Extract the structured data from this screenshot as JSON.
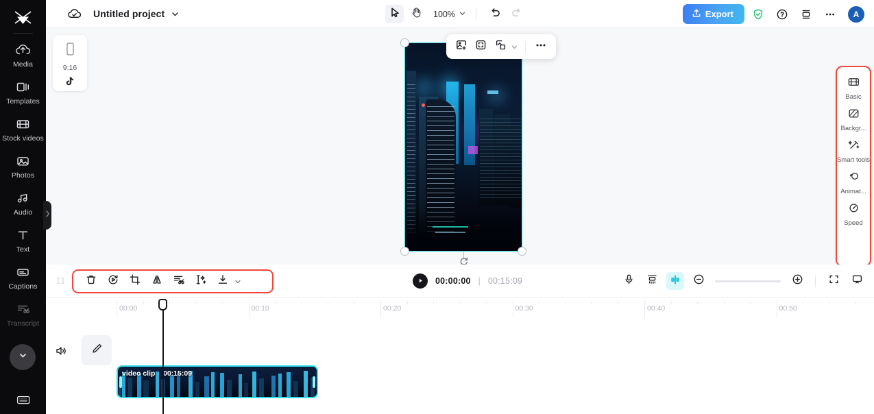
{
  "app": {
    "name": "CapCut Web Editor",
    "accent_blue": "#3a7df5",
    "accent_cyan": "#2ee0ea",
    "highlight_red": "#f2463a"
  },
  "sidebar": {
    "logo_icon": "capcut-logo-icon",
    "items": [
      {
        "label": "Media",
        "icon": "cloud-upload-icon"
      },
      {
        "label": "Templates",
        "icon": "templates-icon"
      },
      {
        "label": "Stock videos",
        "icon": "film-strip-icon"
      },
      {
        "label": "Photos",
        "icon": "photo-icon"
      },
      {
        "label": "Audio",
        "icon": "music-note-icon"
      },
      {
        "label": "Text",
        "icon": "text-t-icon"
      },
      {
        "label": "Captions",
        "icon": "captions-icon"
      },
      {
        "label": "Transcript",
        "icon": "transcript-scissors-icon"
      }
    ],
    "collapse_icon": "chevron-down-icon",
    "keyboard_icon": "keyboard-icon",
    "panel_handle_icon": "chevron-right-icon"
  },
  "topbar": {
    "cloud_icon": "cloud-saved-icon",
    "project_title": "Untitled project",
    "title_caret_icon": "chevron-down-icon",
    "tools": [
      {
        "name": "select-tool",
        "icon": "cursor-arrow-icon",
        "active": true
      },
      {
        "name": "hand-tool",
        "icon": "hand-icon",
        "active": false
      }
    ],
    "zoom_level": "100%",
    "zoom_caret_icon": "chevron-down-icon",
    "undo_icon": "undo-arrow-icon",
    "redo_icon": "redo-arrow-icon",
    "export_label": "Export",
    "export_icon": "upload-icon",
    "right_icons": [
      {
        "name": "shield-check-icon"
      },
      {
        "name": "help-question-icon"
      },
      {
        "name": "layers-stack-icon"
      },
      {
        "name": "more-horizontal-icon"
      }
    ],
    "avatar_initial": "A"
  },
  "stage": {
    "ratio_card": {
      "label": "9:16",
      "frame_icon": "phone-portrait-icon",
      "platform_icon": "tiktok-icon"
    },
    "floating_toolbar": [
      {
        "name": "add-image-button",
        "icon": "image-plus-icon"
      },
      {
        "name": "auto-reframe-button",
        "icon": "reframe-icon"
      },
      {
        "name": "remove-background-button",
        "icon": "remove-bg-icon"
      },
      {
        "name": "remove-bg-caret",
        "icon": "chevron-down-icon"
      },
      {
        "name": "more-options-button",
        "icon": "more-horizontal-icon"
      }
    ],
    "preview_alt": "night city skyline with neon blue skyscrapers",
    "rotate_handle_icon": "rotate-icon"
  },
  "right_panel": {
    "items": [
      {
        "label": "Basic",
        "icon": "film-strip-icon"
      },
      {
        "label": "Backgr...",
        "icon": "background-square-icon"
      },
      {
        "label": "Smart tools",
        "icon": "magic-wand-icon"
      },
      {
        "label": "Animat...",
        "icon": "animation-circles-icon"
      },
      {
        "label": "Speed",
        "icon": "speedometer-icon"
      }
    ]
  },
  "clip_toolbar": {
    "left_mini_icon": "split-marker-icon",
    "buttons": [
      {
        "name": "delete-button",
        "icon": "trash-icon"
      },
      {
        "name": "rotate-button",
        "icon": "rotate-play-icon"
      },
      {
        "name": "crop-button",
        "icon": "crop-icon"
      },
      {
        "name": "mirror-button",
        "icon": "mirror-flip-icon"
      },
      {
        "name": "cut-audio-button",
        "icon": "scissors-lines-icon"
      },
      {
        "name": "split-ai-button",
        "icon": "split-sparkle-icon"
      },
      {
        "name": "download-button",
        "icon": "download-icon"
      }
    ],
    "download_caret_icon": "chevron-down-icon"
  },
  "player": {
    "play_icon": "play-triangle-icon",
    "current_time": "00:00:00",
    "separator": "|",
    "total_time": "00:15:09"
  },
  "right_controls": [
    {
      "name": "record-voiceover-button",
      "icon": "microphone-icon",
      "active": false
    },
    {
      "name": "auto-adjust-button",
      "icon": "magnet-adjust-icon",
      "active": false
    },
    {
      "name": "split-marker-button",
      "icon": "split-marker-icon",
      "active": true
    },
    {
      "name": "zoom-out-button",
      "icon": "minus-circle-icon",
      "active": false
    },
    {
      "name": "zoom-in-button",
      "icon": "plus-circle-icon",
      "active": false
    },
    {
      "name": "fit-to-screen-button",
      "icon": "fit-screen-icon",
      "active": false
    },
    {
      "name": "preview-monitor-button",
      "icon": "monitor-icon",
      "active": false
    }
  ],
  "timeline": {
    "ruler_labels": [
      "00:00",
      "00:10",
      "00:20",
      "00:30",
      "00:40",
      "00:50"
    ],
    "playhead_time": "00:00:00",
    "track": {
      "mute_icon": "speaker-on-icon",
      "edit_icon": "pencil-edit-icon",
      "clip": {
        "title": "video clip",
        "duration": "00:15:09"
      }
    }
  }
}
